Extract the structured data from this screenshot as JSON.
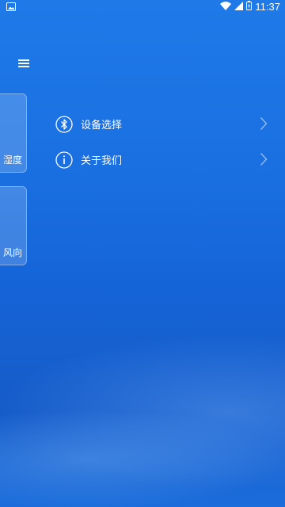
{
  "status_bar": {
    "time": "11:37",
    "icons": [
      "image-icon",
      "wifi-icon",
      "cell-signal-icon",
      "battery-charging-icon"
    ]
  },
  "header": {
    "menu_icon": "hamburger-menu-icon"
  },
  "side_cards": [
    {
      "label": "湿度"
    },
    {
      "label": "风向"
    }
  ],
  "drawer": {
    "items": [
      {
        "label": "设备选择",
        "icon": "bluetooth-icon"
      },
      {
        "label": "关于我们",
        "icon": "info-icon"
      }
    ]
  },
  "colors": {
    "background_top": "#1f7ae8",
    "background_bottom": "#1565d9",
    "text": "#ffffff"
  }
}
